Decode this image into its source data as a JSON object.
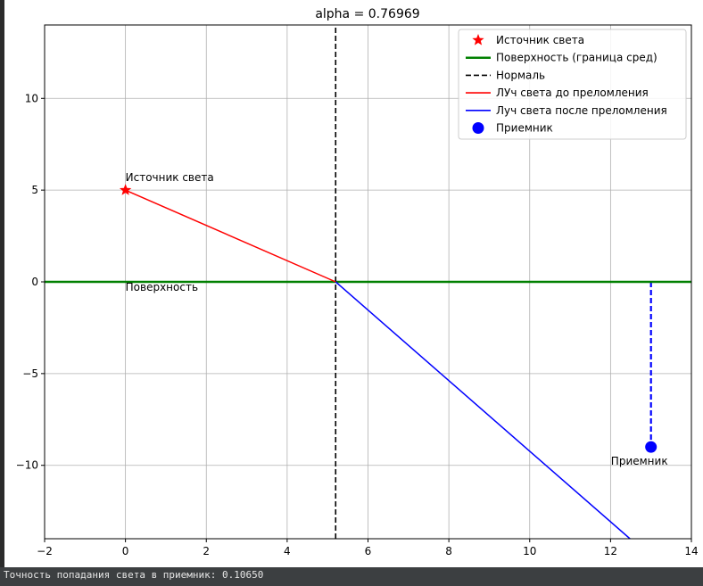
{
  "console": {
    "text": "Точность попадания света в приемник: 0.10650"
  },
  "chart_data": {
    "type": "line",
    "title": "alpha = 0.76969",
    "xlabel": "",
    "ylabel": "",
    "xlim": [
      -2,
      14
    ],
    "ylim": [
      -14,
      14
    ],
    "xticks": [
      -2,
      0,
      2,
      4,
      6,
      8,
      10,
      12,
      14
    ],
    "yticks": [
      -10,
      -5,
      0,
      5,
      10
    ],
    "ytick_labels": [
      "−10",
      "−5",
      "0",
      "5",
      "10"
    ],
    "xtick_labels": [
      "−2",
      "0",
      "2",
      "4",
      "6",
      "8",
      "10",
      "12",
      "14"
    ],
    "grid": true,
    "legend_position": "top-right",
    "series": [
      {
        "name": "Источник света",
        "kind": "marker",
        "marker": "star",
        "color": "#ff0000",
        "points": [
          [
            0,
            5
          ]
        ]
      },
      {
        "name": "Поверхность (граница сред)",
        "kind": "line",
        "style": "solid",
        "color": "#008000",
        "points": [
          [
            -2,
            0
          ],
          [
            14,
            0
          ]
        ]
      },
      {
        "name": "Нормаль",
        "kind": "line",
        "style": "dashed",
        "color": "#000000",
        "points": [
          [
            5.2,
            -14
          ],
          [
            5.2,
            14
          ]
        ]
      },
      {
        "name": "ЛУч света до преломления",
        "kind": "line",
        "style": "solid",
        "color": "#ff0000",
        "points": [
          [
            0,
            5
          ],
          [
            5.2,
            0
          ]
        ]
      },
      {
        "name": "Луч света после преломления",
        "kind": "line",
        "style": "solid",
        "color": "#0000ff",
        "points": [
          [
            5.2,
            0
          ],
          [
            12.48,
            -14
          ]
        ]
      },
      {
        "name": "Приемник",
        "kind": "marker",
        "marker": "circle",
        "color": "#0000ff",
        "points": [
          [
            13,
            -9
          ]
        ]
      }
    ],
    "extra_lines": [
      {
        "style": "dashed",
        "color": "#0000ff",
        "points": [
          [
            13,
            0
          ],
          [
            13,
            -9
          ]
        ]
      }
    ],
    "annotations": [
      {
        "text": "Источник света",
        "x": 0,
        "y": 5,
        "anchor": "above-right"
      },
      {
        "text": "Поверхность",
        "x": 0,
        "y": 0,
        "anchor": "below-right"
      },
      {
        "text": "Приемник",
        "x": 13,
        "y": -9,
        "anchor": "below-center"
      }
    ]
  }
}
